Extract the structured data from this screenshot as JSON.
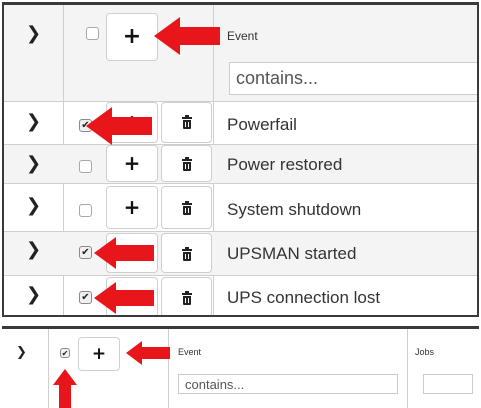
{
  "header": {
    "expand_icon": "chevron-right-icon",
    "add_label": "+",
    "event_label": "Event",
    "filter_placeholder": "contains..."
  },
  "rows": [
    {
      "name": "Powerfail",
      "checked": true,
      "expand_icon": "chevron-right-icon",
      "delete_icon": "trash-icon",
      "add_label": "+"
    },
    {
      "name": "Power restored",
      "checked": false,
      "expand_icon": "chevron-right-icon",
      "delete_icon": "trash-icon",
      "add_label": "+"
    },
    {
      "name": "System shutdown",
      "checked": false,
      "expand_icon": "chevron-right-icon",
      "delete_icon": "trash-icon",
      "add_label": "+"
    },
    {
      "name": "UPSMAN started",
      "checked": true,
      "expand_icon": "chevron-right-icon",
      "delete_icon": "trash-icon",
      "add_label": "+"
    },
    {
      "name": "UPS connection lost",
      "checked": true,
      "expand_icon": "chevron-right-icon",
      "delete_icon": "trash-icon",
      "add_label": "+"
    }
  ],
  "mini_header": {
    "add_label": "+",
    "event_label": "Event",
    "jobs_label": "Jobs",
    "filter_placeholder": "contains...",
    "checked": true
  },
  "glyphs": {
    "chevron": "❯",
    "check": "✔"
  },
  "colors": {
    "annotation_red": "#e8161b",
    "grid_border": "#3a3a3a",
    "header_bg": "#f4f4f4"
  }
}
